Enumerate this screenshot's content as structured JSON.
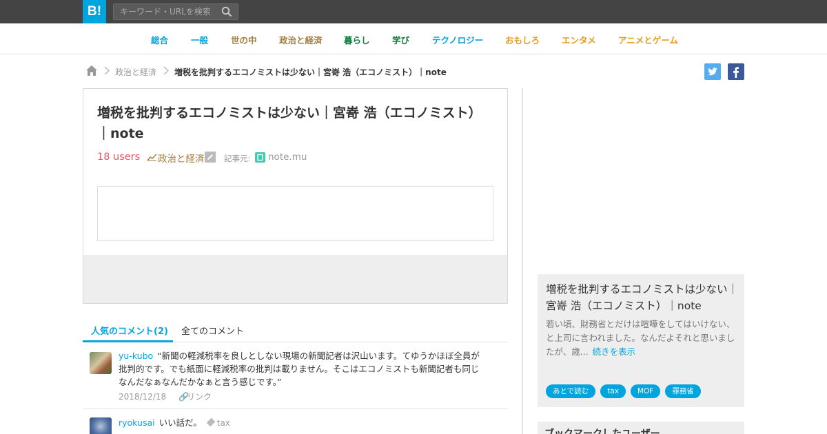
{
  "header": {
    "logo_text": "B!",
    "search_placeholder": "キーワード・URLを検索"
  },
  "categories": [
    {
      "label": "総合",
      "color": "#00a4de"
    },
    {
      "label": "一般",
      "color": "#00a4de"
    },
    {
      "label": "世の中",
      "color": "#a47e3f"
    },
    {
      "label": "政治と経済",
      "color": "#a47e3f"
    },
    {
      "label": "暮らし",
      "color": "#0f7d3b"
    },
    {
      "label": "学び",
      "color": "#0f7d3b"
    },
    {
      "label": "テクノロジー",
      "color": "#00a4de"
    },
    {
      "label": "おもしろ",
      "color": "#e89b1b"
    },
    {
      "label": "エンタメ",
      "color": "#e89b1b"
    },
    {
      "label": "アニメとゲーム",
      "color": "#e89b1b"
    }
  ],
  "breadcrumb": {
    "category": "政治と経済",
    "title": "増税を批判するエコノミストは少ない｜宮嵜 浩（エコノミスト）｜note"
  },
  "entry": {
    "title": "増税を批判するエコノミストは少ない｜宮嵜 浩（エコノミスト）｜note",
    "users": "18 users",
    "category": "政治と経済",
    "source_label": "記事元:",
    "source_domain": "note.mu"
  },
  "comment_tabs": {
    "popular": "人気のコメント(2)",
    "all": "全てのコメント"
  },
  "comments": [
    {
      "user": "yu-kubo",
      "text": "“新聞の軽減税率を良しとしない現場の新聞記者は沢山います。てゆうかほぼ全員が批判的です。でも紙面に軽減税率の批判は載りません。そこはエコノミストも新聞記者も同じなんだなぁなんだかなぁと言う感じです。”",
      "date": "2018/12/18",
      "link_label": "リンク"
    },
    {
      "user": "ryokusai",
      "text": "いい話だ。",
      "tag": "tax"
    }
  ],
  "sidebar": {
    "title": "増税を批判するエコノミストは少ない｜宮嵜 浩（エコノミスト）｜note",
    "summary": "若い頃、財務省とだけは喧嘩をしてはいけない、と上司に言われました。なんだよそれと思いましたが、歳...",
    "more_label": "続きを表示",
    "tags": [
      "あとで読む",
      "tax",
      "MOF",
      "罪務省"
    ],
    "users_heading": "ブックマークしたユーザー"
  },
  "colors": {
    "accent": "#00a4de",
    "users": "#e85862",
    "topbar": "#444444"
  }
}
